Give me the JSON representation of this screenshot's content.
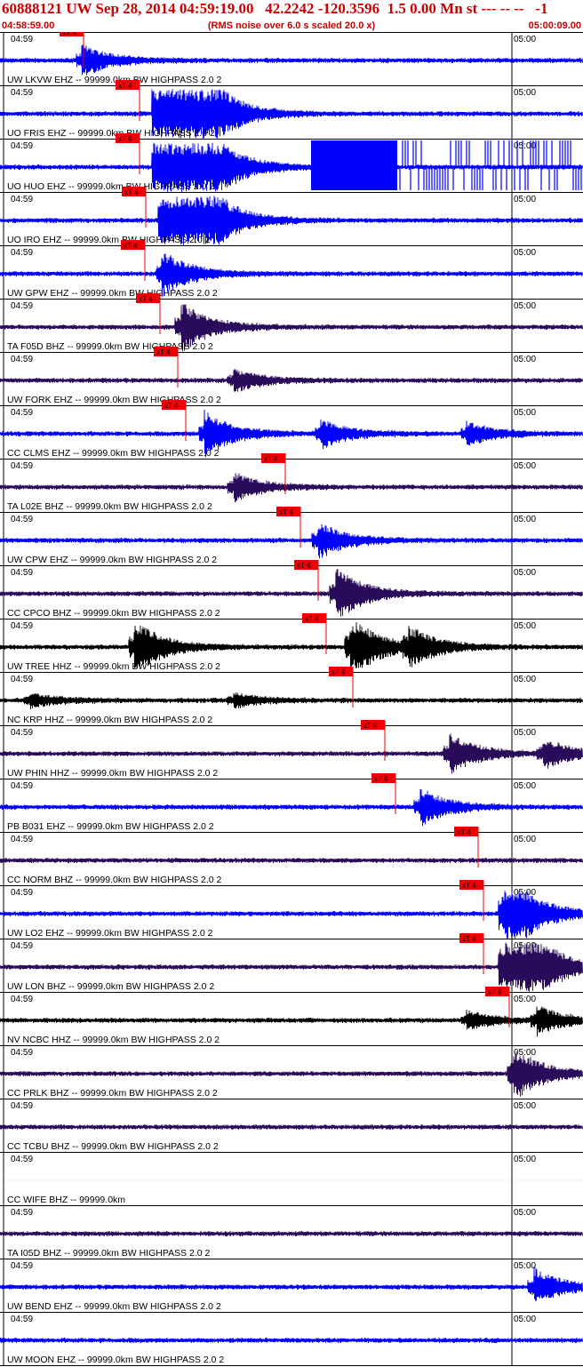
{
  "header": {
    "title": "60888121 UW Sep 28, 2014 04:59:19.00   42.2242 -120.3596  1.5 0.00 Mn st --- -- --   -1",
    "start_time": "04:58:59.00",
    "note": "(RMS noise over 6.0 s scaled 20.0 x)",
    "end_time": "05:00:09.00"
  },
  "chart_data": {
    "type": "line",
    "tick_labels": [
      "04:59",
      "05:00"
    ],
    "pick_label": "xT 4",
    "colors": {
      "frame": "#000000",
      "pick": "#ee0000",
      "blue": "#0000ff",
      "purple": "#2a0a5a",
      "black": "#000000",
      "title": "#cc0000"
    },
    "traces": [
      {
        "label": "UW LKVW EHZ -- 99999.0km BW  HIGHPASS  2.0  2",
        "color": "blue",
        "pick": 0.143,
        "bursts": [
          [
            0.14,
            0.7
          ]
        ],
        "clip": false
      },
      {
        "label": "UO FRIS EHZ -- 99999.0km BW  HIGHPASS  2.0  2",
        "color": "blue",
        "pick": 0.24,
        "bursts": [
          [
            0.27,
            4.0
          ],
          [
            0.33,
            2.0
          ]
        ],
        "clip": false
      },
      {
        "label": "UO HUO EHZ -- 99999.0km BW  HIGHPASS  2.0  2",
        "color": "blue",
        "pick": 0.24,
        "bursts": [
          [
            0.27,
            4.0
          ],
          [
            0.33,
            2.0
          ]
        ],
        "clip": true
      },
      {
        "label": "UO IRO EHZ -- 99999.0km BW  HIGHPASS  2.0  2",
        "color": "blue",
        "pick": 0.25,
        "bursts": [
          [
            0.28,
            4.0
          ],
          [
            0.33,
            1.5
          ]
        ],
        "clip": false
      },
      {
        "label": "UW GPW EHZ -- 99999.0km BW  HIGHPASS  2.0  2",
        "color": "blue",
        "pick": 0.248,
        "bursts": [
          [
            0.277,
            1.0
          ]
        ],
        "clip": false
      },
      {
        "label": "TA F05D BHZ -- 99999.0km BW  HIGHPASS  2.0  2",
        "color": "purple",
        "pick": 0.275,
        "bursts": [
          [
            0.31,
            1.1
          ]
        ],
        "clip": false
      },
      {
        "label": "UW FORK EHZ -- 99999.0km BW  HIGHPASS  2.0  2",
        "color": "purple",
        "pick": 0.305,
        "bursts": [
          [
            0.4,
            0.5
          ]
        ],
        "clip": false
      },
      {
        "label": "CC CLMS EHZ -- 99999.0km BW  HIGHPASS  2.0  2",
        "color": "blue",
        "pick": 0.318,
        "bursts": [
          [
            0.35,
            1.0
          ],
          [
            0.55,
            0.6
          ],
          [
            0.8,
            0.5
          ]
        ],
        "clip": false
      },
      {
        "label": "TA L02E BHZ -- 99999.0km BW  HIGHPASS  2.0  2",
        "color": "purple",
        "pick": 0.49,
        "bursts": [
          [
            0.4,
            0.6
          ]
        ],
        "clip": false
      },
      {
        "label": "UW CPW EHZ -- 99999.0km BW  HIGHPASS  2.0  2",
        "color": "blue",
        "pick": 0.515,
        "bursts": [
          [
            0.545,
            0.8
          ]
        ],
        "clip": false
      },
      {
        "label": "CC CPCO BHZ -- 99999.0km BW  HIGHPASS  2.0  2",
        "color": "purple",
        "pick": 0.545,
        "bursts": [
          [
            0.575,
            1.2
          ]
        ],
        "clip": false
      },
      {
        "label": "UW TREE HHZ -- 99999.0km BW  HIGHPASS  2.0  2",
        "color": "black",
        "pick": 0.56,
        "bursts": [
          [
            0.23,
            1.2
          ],
          [
            0.6,
            1.4
          ],
          [
            0.7,
            0.8
          ]
        ],
        "clip": false
      },
      {
        "label": "NC KRP HHZ -- 99999.0km BW  HIGHPASS  2.0  2",
        "color": "black",
        "pick": 0.605,
        "bursts": [
          [
            0.05,
            0.3
          ],
          [
            0.4,
            0.3
          ]
        ],
        "clip": false
      },
      {
        "label": "UW PHIN HHZ -- 99999.0km BW  HIGHPASS  2.0  2",
        "color": "purple",
        "pick": 0.66,
        "bursts": [
          [
            0.77,
            0.9
          ],
          [
            0.93,
            0.7
          ]
        ],
        "clip": false
      },
      {
        "label": "PB B031 EHZ -- 99999.0km BW  HIGHPASS  2.0  2",
        "color": "blue",
        "pick": 0.678,
        "bursts": [
          [
            0.72,
            0.8
          ]
        ],
        "clip": false
      },
      {
        "label": "CC NORM BHZ -- 99999.0km BW  HIGHPASS  2.0  2",
        "color": "purple",
        "pick": 0.82,
        "bursts": [],
        "clip": false
      },
      {
        "label": "UW LO2 EHZ -- 99999.0km BW  HIGHPASS  2.0  2",
        "color": "blue",
        "pick": 0.83,
        "bursts": [
          [
            0.865,
            2.2
          ]
        ],
        "clip": false
      },
      {
        "label": "UW LON BHZ -- 99999.0km BW  HIGHPASS  2.0  2",
        "color": "purple",
        "pick": 0.83,
        "bursts": [
          [
            0.865,
            2.5
          ],
          [
            0.91,
            0.8
          ]
        ],
        "clip": false
      },
      {
        "label": "NV NCBC HHZ -- 99999.0km BW  HIGHPASS  2.0  2",
        "color": "black",
        "pick": 0.873,
        "bursts": [
          [
            0.8,
            0.4
          ],
          [
            0.92,
            0.6
          ]
        ],
        "clip": false
      },
      {
        "label": "CC PRLK BHZ -- 99999.0km BW  HIGHPASS  2.0  2",
        "color": "purple",
        "pick": null,
        "bursts": [
          [
            0.88,
            1.2
          ]
        ],
        "clip": false
      },
      {
        "label": "CC TCBU BHZ -- 99999.0km BW  HIGHPASS  2.0  2",
        "color": "purple",
        "pick": null,
        "bursts": [],
        "clip": false
      },
      {
        "label": "CC WIFE BHZ -- 99999.0km",
        "color": "purple",
        "pick": null,
        "bursts": [],
        "clip": false,
        "flat": true
      },
      {
        "label": "TA I05D BHZ -- 99999.0km BW  HIGHPASS  2.0  2",
        "color": "purple",
        "pick": null,
        "bursts": [],
        "clip": false
      },
      {
        "label": "UW BEND EHZ -- 99999.0km BW  HIGHPASS  2.0  2",
        "color": "blue",
        "pick": null,
        "bursts": [
          [
            0.915,
            0.8
          ]
        ],
        "clip": false
      },
      {
        "label": "UW MOON EHZ -- 99999.0km BW  HIGHPASS  2.0  2",
        "color": "blue",
        "pick": null,
        "bursts": [],
        "clip": false
      }
    ]
  }
}
